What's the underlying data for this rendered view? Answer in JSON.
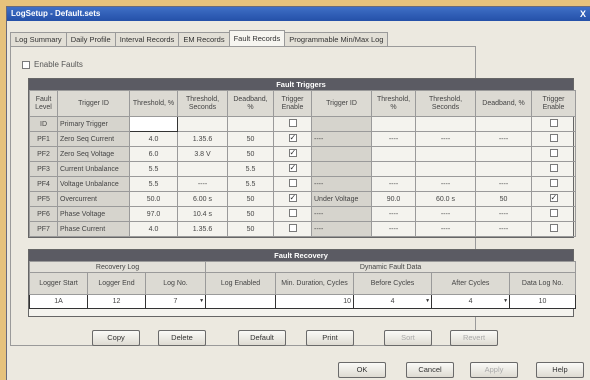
{
  "window": {
    "title": "LogSetup - Default.sets",
    "close_label": "X"
  },
  "tabs": [
    "Log Summary",
    "Daily Profile",
    "Interval Records",
    "EM Records",
    "Fault Records",
    "Programmable Min/Max Log"
  ],
  "enable_checkbox": {
    "label": "Enable Faults",
    "checked": false
  },
  "fault_table": {
    "title": "Fault Triggers",
    "columns": [
      "Fault Level",
      "Trigger ID",
      "Threshold, %",
      "Threshold, Seconds",
      "Deadband, %",
      "Trigger Enable",
      "Trigger ID",
      "Threshold, %",
      "Threshold, Seconds",
      "Deadband, %",
      "Trigger Enable"
    ],
    "rows": [
      {
        "level": "ID",
        "id": "Primary Trigger",
        "t1": "",
        "t2": "",
        "db": "",
        "en": false,
        "id2": "",
        "u1": "",
        "u2": "",
        "udb": "",
        "uen": false
      },
      {
        "level": "PF1",
        "id": "Zero Seq Current",
        "t1": "4.0",
        "t2": "1.35.6",
        "db": "50",
        "en": true,
        "id2": "----",
        "u1": "----",
        "u2": "----",
        "udb": "----",
        "uen": false
      },
      {
        "level": "PF2",
        "id": "Zero Seq Voltage",
        "t1": "6.0",
        "t2": "3.8 V",
        "db": "50",
        "en": true,
        "id2": "",
        "u1": "",
        "u2": "",
        "udb": "",
        "uen": false
      },
      {
        "level": "PF3",
        "id": "Current Unbalance",
        "t1": "5.5",
        "t2": "",
        "db": "5.5",
        "en": true,
        "id2": "",
        "u1": "",
        "u2": "",
        "udb": "",
        "uen": false
      },
      {
        "level": "PF4",
        "id": "Voltage Unbalance",
        "t1": "5.5",
        "t2": "----",
        "db": "5.5",
        "en": false,
        "id2": "----",
        "u1": "----",
        "u2": "----",
        "udb": "----",
        "uen": false
      },
      {
        "level": "PF5",
        "id": "Overcurrent",
        "t1": "50.0",
        "t2": "6.00 s",
        "db": "50",
        "en": true,
        "id2": "Under Voltage",
        "u1": "90.0",
        "u2": "60.0 s",
        "udb": "50",
        "uen": true
      },
      {
        "level": "PF6",
        "id": "Phase Voltage",
        "t1": "97.0",
        "t2": "10.4 s",
        "db": "50",
        "en": false,
        "id2": "----",
        "u1": "----",
        "u2": "----",
        "udb": "----",
        "uen": false
      },
      {
        "level": "PF7",
        "id": "Phase Current",
        "t1": "4.0",
        "t2": "1.35.6",
        "db": "50",
        "en": false,
        "id2": "----",
        "u1": "----",
        "u2": "----",
        "udb": "----",
        "uen": false
      }
    ]
  },
  "recovery_table": {
    "title": "Fault Recovery",
    "group1": "Recovery Log",
    "group2": "Dynamic Fault Data",
    "columns": [
      "Logger Start",
      "Logger End",
      "Log No.",
      "Log Enabled",
      "Min. Duration, Cycles",
      "Before Cycles",
      "After Cycles",
      "Data Log No."
    ],
    "values": [
      "1A",
      "12",
      "7",
      "",
      "10",
      "4",
      "4",
      "10"
    ]
  },
  "buttons": {
    "copy": "Copy",
    "delete": "Delete",
    "default": "Default",
    "print": "Print",
    "sort": "Sort",
    "revert": "Revert",
    "ok": "OK",
    "cancel": "Cancel",
    "apply": "Apply",
    "help": "Help"
  }
}
